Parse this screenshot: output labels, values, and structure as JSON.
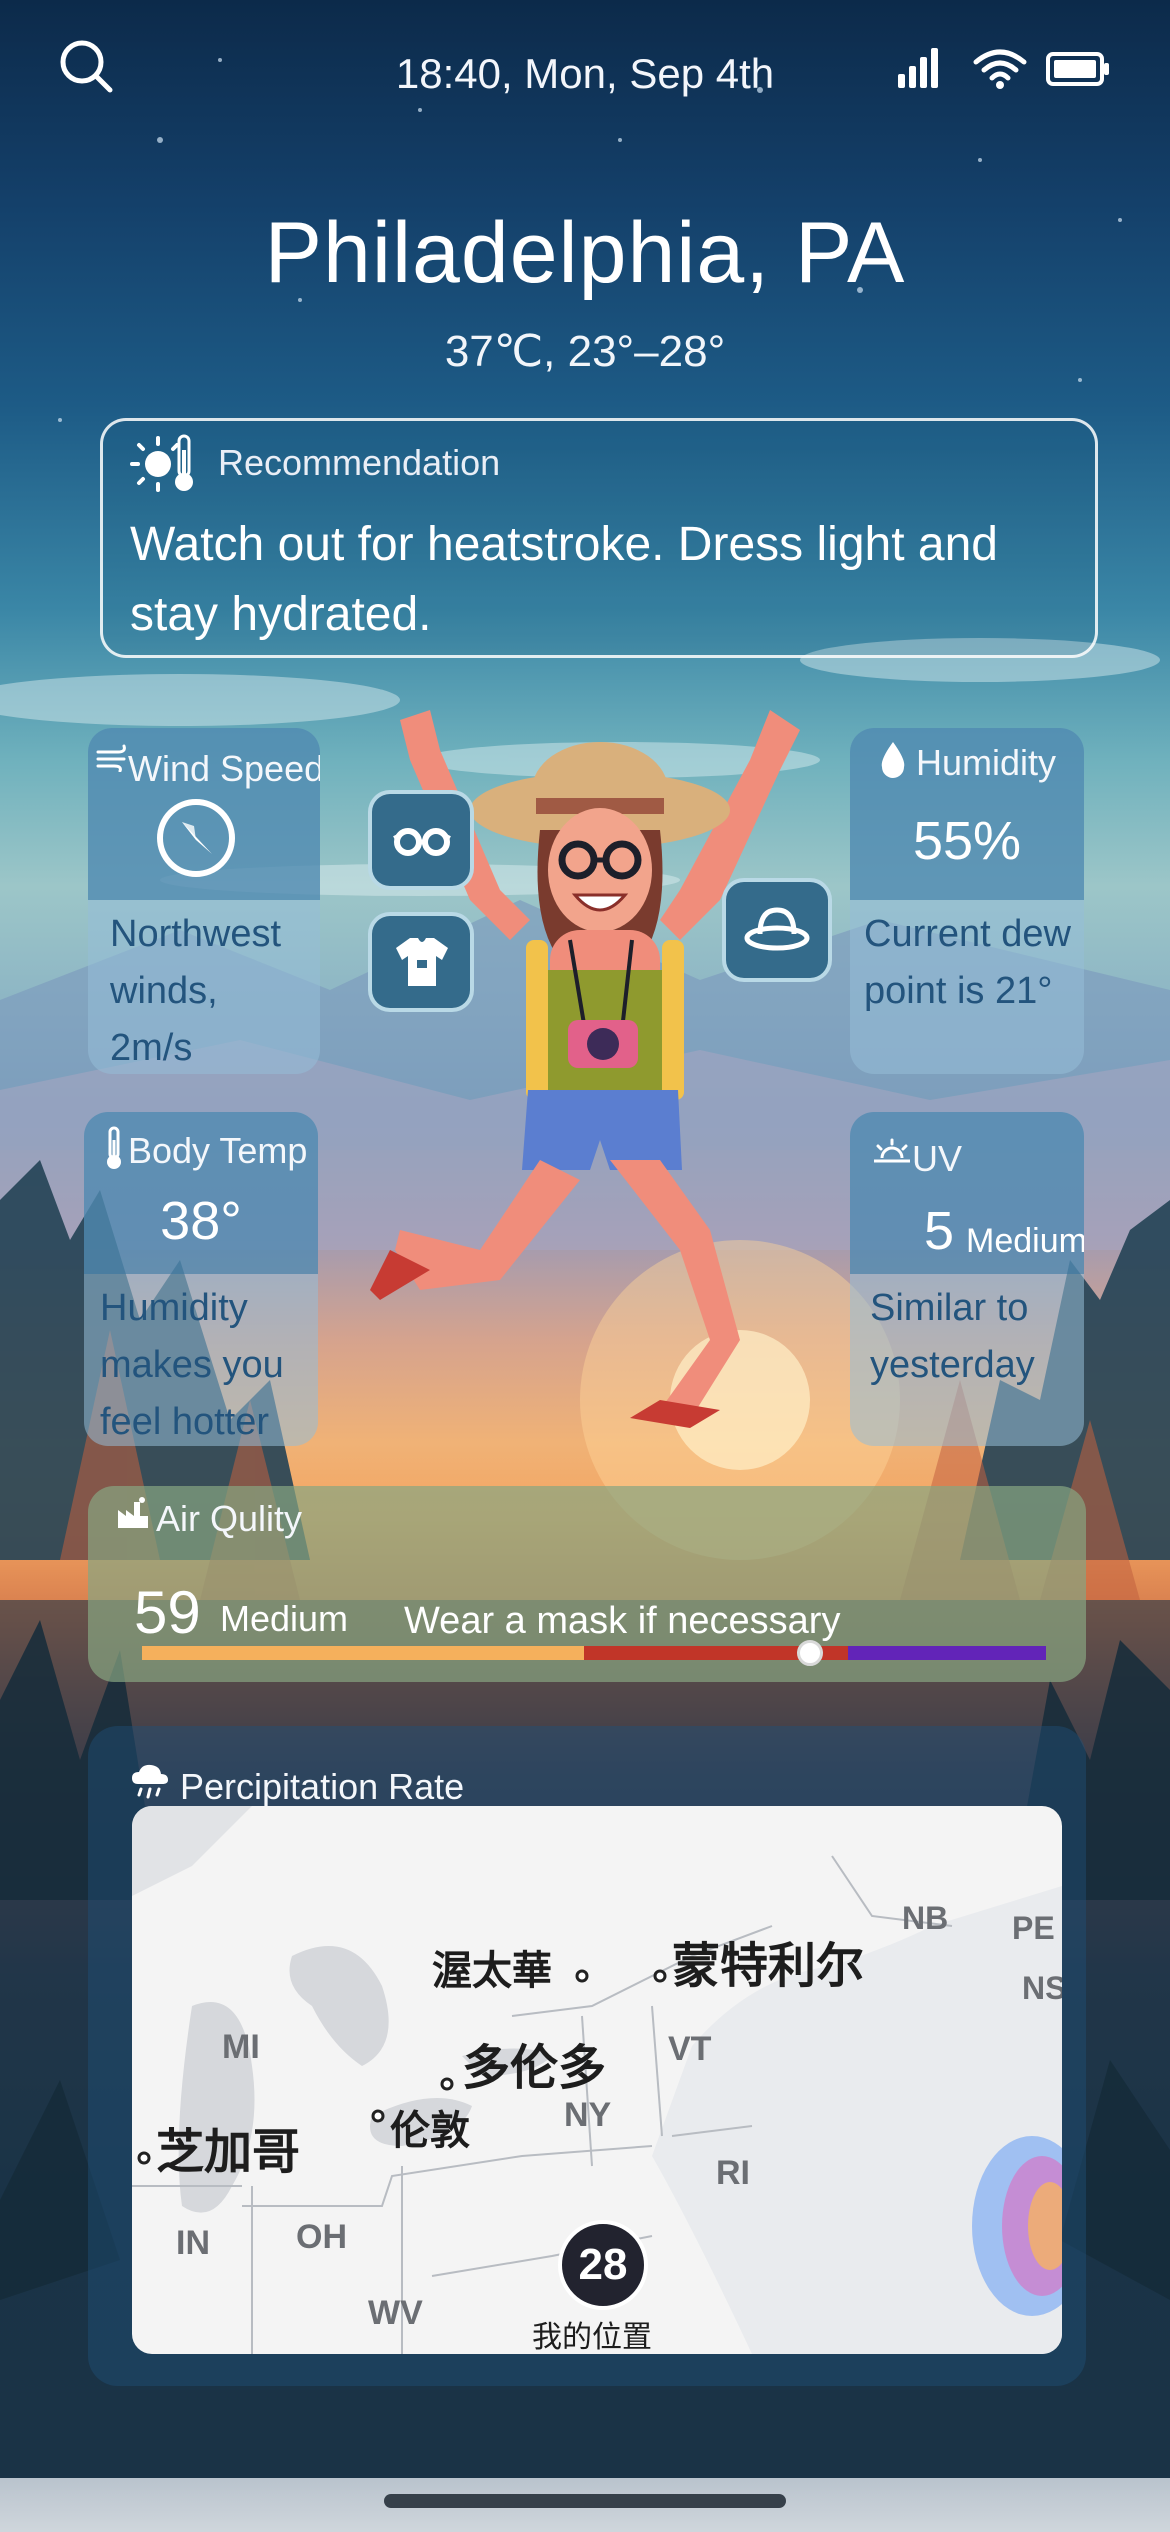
{
  "status_bar": {
    "time": "18:40, Mon, Sep 4th"
  },
  "location": {
    "city": "Philadelphia, PA",
    "temps": "37℃, 23°–28°"
  },
  "recommendation": {
    "title": "Recommendation",
    "text": "Watch out for heatstroke. Dress light and stay hydrated."
  },
  "wind": {
    "title": "Wind Speed",
    "desc": "Northwest winds, 2m/s"
  },
  "humidity": {
    "title": "Humidity",
    "value": "55%",
    "desc": "Current dew point is 21°"
  },
  "body_temp": {
    "title": "Body Temp",
    "value": "38°",
    "desc": "Humidity makes you feel hotter"
  },
  "uv": {
    "title": "UV",
    "value": "5",
    "level": "Medium",
    "desc": "Similar to yesterday"
  },
  "air_quality": {
    "title": "Air Qulity",
    "value": "59",
    "level": "Medium",
    "advice": "Wear a mask if necessary",
    "indicator_fraction": 0.739,
    "bar_colors": [
      "#f5b05c",
      "#c13528",
      "#6224b8"
    ]
  },
  "precipitation": {
    "title": "Percipitation Rate",
    "map_labels": {
      "ottawa": "渥太華",
      "montreal": "蒙特利尔",
      "toronto": "多伦多",
      "london": "伦敦",
      "chicago": "芝加哥",
      "nb": "NB",
      "pe": "PE",
      "ns": "NS",
      "mi": "MI",
      "vt": "VT",
      "ny": "NY",
      "ri": "RI",
      "in": "IN",
      "oh": "OH",
      "wv": "WV"
    },
    "marker_value": "28",
    "marker_label": "我的位置"
  },
  "colors": {
    "card_top": "#3273a0",
    "card_body": "#96bed7",
    "card_text": "#23547d",
    "icon_button": "#346b8b"
  },
  "icons": [
    "search-icon",
    "signal-icon",
    "wifi-icon",
    "battery-icon",
    "sun-thermometer-icon",
    "wind-icon",
    "compass-icon",
    "droplet-icon",
    "thermometer-icon",
    "sun-horizon-icon",
    "factory-icon",
    "cloud-rain-icon",
    "glasses-icon",
    "shirt-icon",
    "hat-icon"
  ]
}
